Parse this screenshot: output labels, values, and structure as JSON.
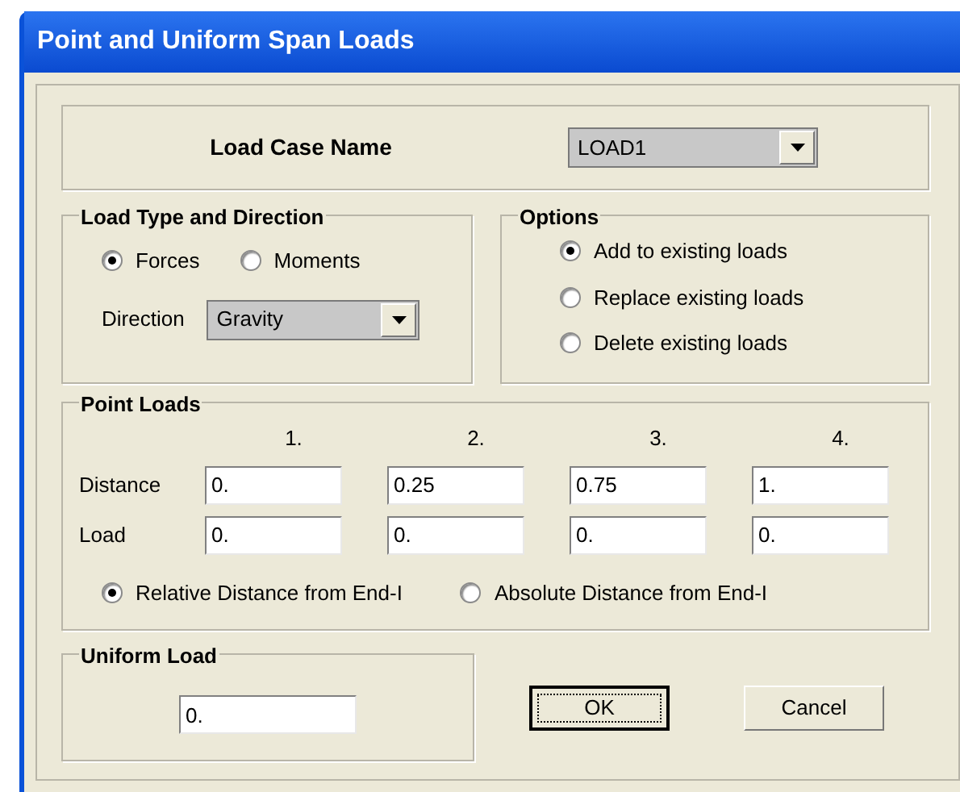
{
  "window": {
    "title": "Point and Uniform Span Loads"
  },
  "load_case": {
    "label": "Load Case Name",
    "value": "LOAD1"
  },
  "load_type": {
    "title": "Load Type and Direction",
    "options": [
      {
        "label": "Forces",
        "selected": true
      },
      {
        "label": "Moments",
        "selected": false
      }
    ],
    "direction": {
      "label": "Direction",
      "value": "Gravity"
    }
  },
  "options": {
    "title": "Options",
    "items": [
      {
        "label": "Add to existing loads",
        "selected": true
      },
      {
        "label": "Replace existing loads",
        "selected": false
      },
      {
        "label": "Delete existing loads",
        "selected": false
      }
    ]
  },
  "point_loads": {
    "title": "Point Loads",
    "columns": [
      "1.",
      "2.",
      "3.",
      "4."
    ],
    "rows": [
      {
        "label": "Distance",
        "values": [
          "0.",
          "0.25",
          "0.75",
          "1."
        ]
      },
      {
        "label": "Load",
        "values": [
          "0.",
          "0.",
          "0.",
          "0."
        ]
      }
    ],
    "distance_modes": [
      {
        "label": "Relative Distance from End-I",
        "selected": true
      },
      {
        "label": "Absolute Distance from End-I",
        "selected": false
      }
    ]
  },
  "uniform_load": {
    "title": "Uniform Load",
    "value": "0."
  },
  "buttons": [
    {
      "label": "OK",
      "default": true
    },
    {
      "label": "Cancel",
      "default": false
    }
  ]
}
